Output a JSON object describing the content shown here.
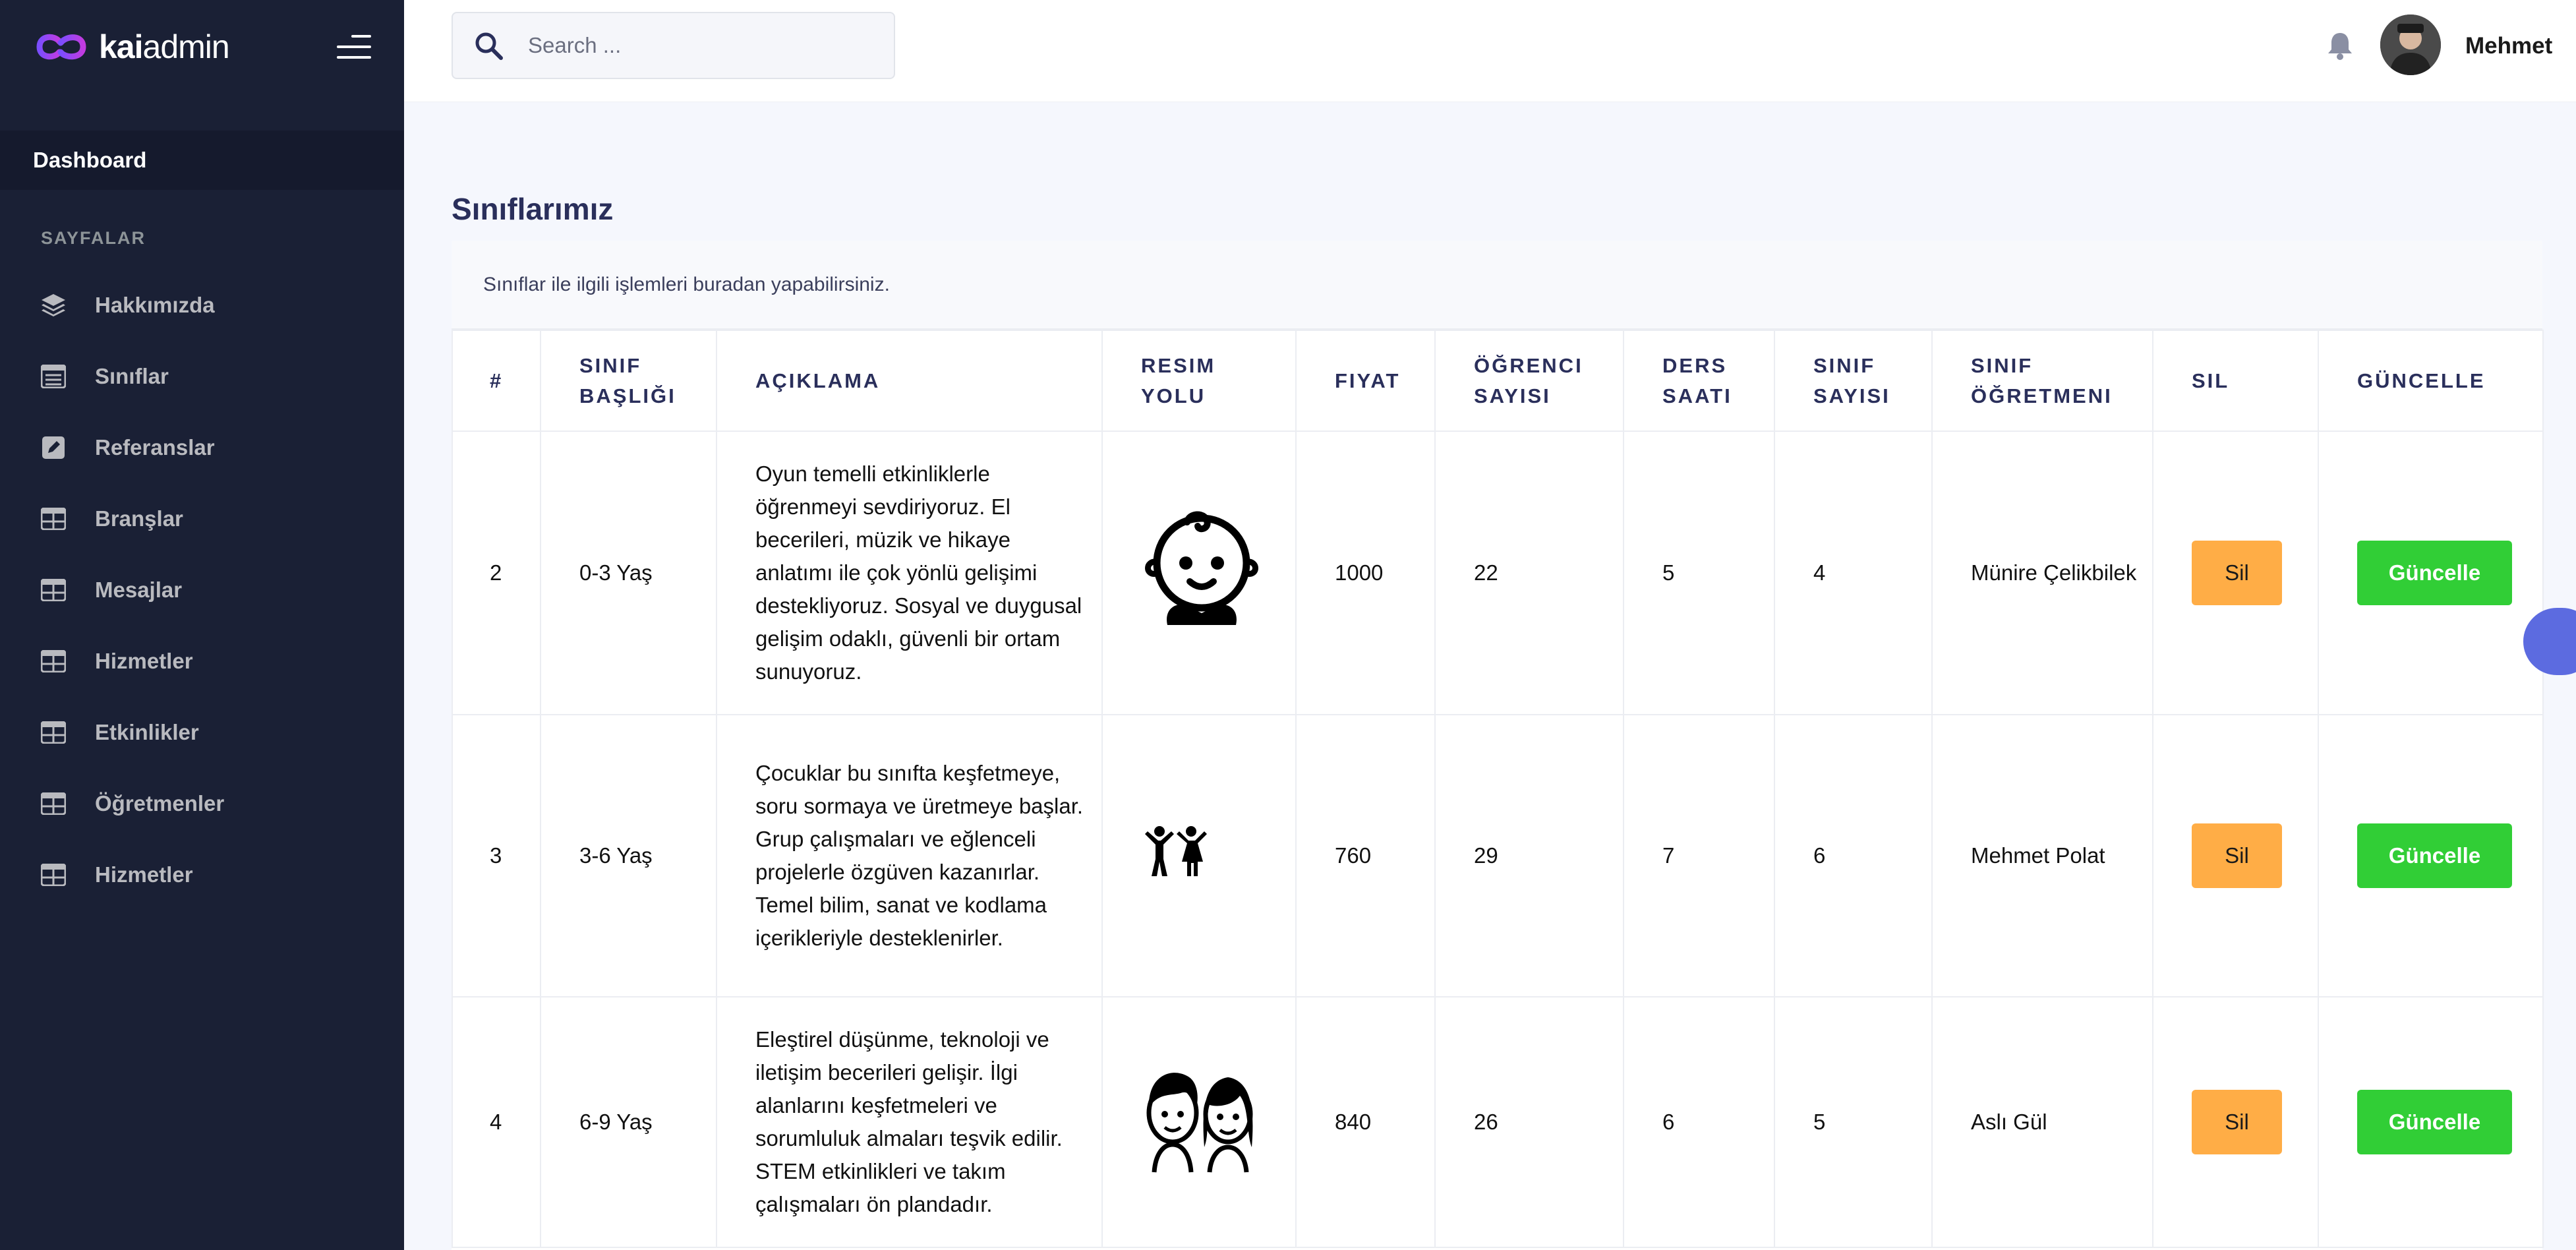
{
  "brand": {
    "name_part1": "kai",
    "name_part2": "admin"
  },
  "sidebar": {
    "dashboard_label": "Dashboard",
    "section_title": "SAYFALAR",
    "items": [
      {
        "label": "Hakkımızda",
        "icon": "layers-icon"
      },
      {
        "label": "Sınıflar",
        "icon": "table-list-icon"
      },
      {
        "label": "Referanslar",
        "icon": "pen-square-icon"
      },
      {
        "label": "Branşlar",
        "icon": "table-icon"
      },
      {
        "label": "Mesajlar",
        "icon": "table-icon"
      },
      {
        "label": "Hizmetler",
        "icon": "table-icon"
      },
      {
        "label": "Etkinlikler",
        "icon": "table-icon"
      },
      {
        "label": "Öğretmenler",
        "icon": "table-icon"
      },
      {
        "label": "Hizmetler",
        "icon": "table-icon"
      }
    ]
  },
  "header": {
    "search_placeholder": "Search ...",
    "user_name": "Mehmet"
  },
  "page": {
    "title": "Sınıflarımız",
    "subtitle": "Sınıflar ile ilgili işlemleri buradan yapabilirsiniz."
  },
  "table": {
    "columns": [
      "#",
      "SINIF BAŞLIĞI",
      "AÇIKLAMA",
      "RESIM YOLU",
      "FIYAT",
      "ÖĞRENCI SAYISI",
      "DERS SAATI",
      "SINIF SAYISI",
      "SINIF ÖĞRETMENI",
      "SIL",
      "GÜNCELLE"
    ],
    "rows": [
      {
        "id": "2",
        "title": "0-3 Yaş",
        "description": "Oyun temelli etkinliklerle öğrenmeyi sevdiriyoruz. El becerileri, müzik ve hikaye anlatımı ile çok yönlü gelişimi destekliyoruz. Sosyal ve duygusal gelişim odaklı, güvenli bir ortam sunuyoruz.",
        "image": "baby-icon",
        "price": "1000",
        "students": "22",
        "hours": "5",
        "class_count": "4",
        "teacher": "Münire Çelikbilek",
        "delete_label": "Sil",
        "update_label": "Güncelle"
      },
      {
        "id": "3",
        "title": "3-6 Yaş",
        "description": "Çocuklar bu sınıfta keşfetmeye, soru sormaya ve üretmeye başlar. Grup çalışmaları ve eğlenceli projelerle özgüven kazanırlar. Temel bilim, sanat ve kodlama içerikleriyle desteklenirler.",
        "image": "children-icon",
        "price": "760",
        "students": "29",
        "hours": "7",
        "class_count": "6",
        "teacher": "Mehmet Polat",
        "delete_label": "Sil",
        "update_label": "Güncelle"
      },
      {
        "id": "4",
        "title": "6-9 Yaş",
        "description": "Eleştirel düşünme, teknoloji ve iletişim becerileri gelişir. İlgi alanlarını keşfetmeleri ve sorumluluk almaları teşvik edilir. STEM etkinlikleri ve takım çalışmaları ön plandadır.",
        "image": "boy-girl-faces-icon",
        "price": "840",
        "students": "26",
        "hours": "6",
        "class_count": "5",
        "teacher": "Aslı Gül",
        "delete_label": "Sil",
        "update_label": "Güncelle"
      }
    ]
  },
  "colors": {
    "sidebar_bg": "#1a2035",
    "accent_purple": "#6861ce",
    "warning": "#ffad46",
    "success": "#31ce36"
  }
}
